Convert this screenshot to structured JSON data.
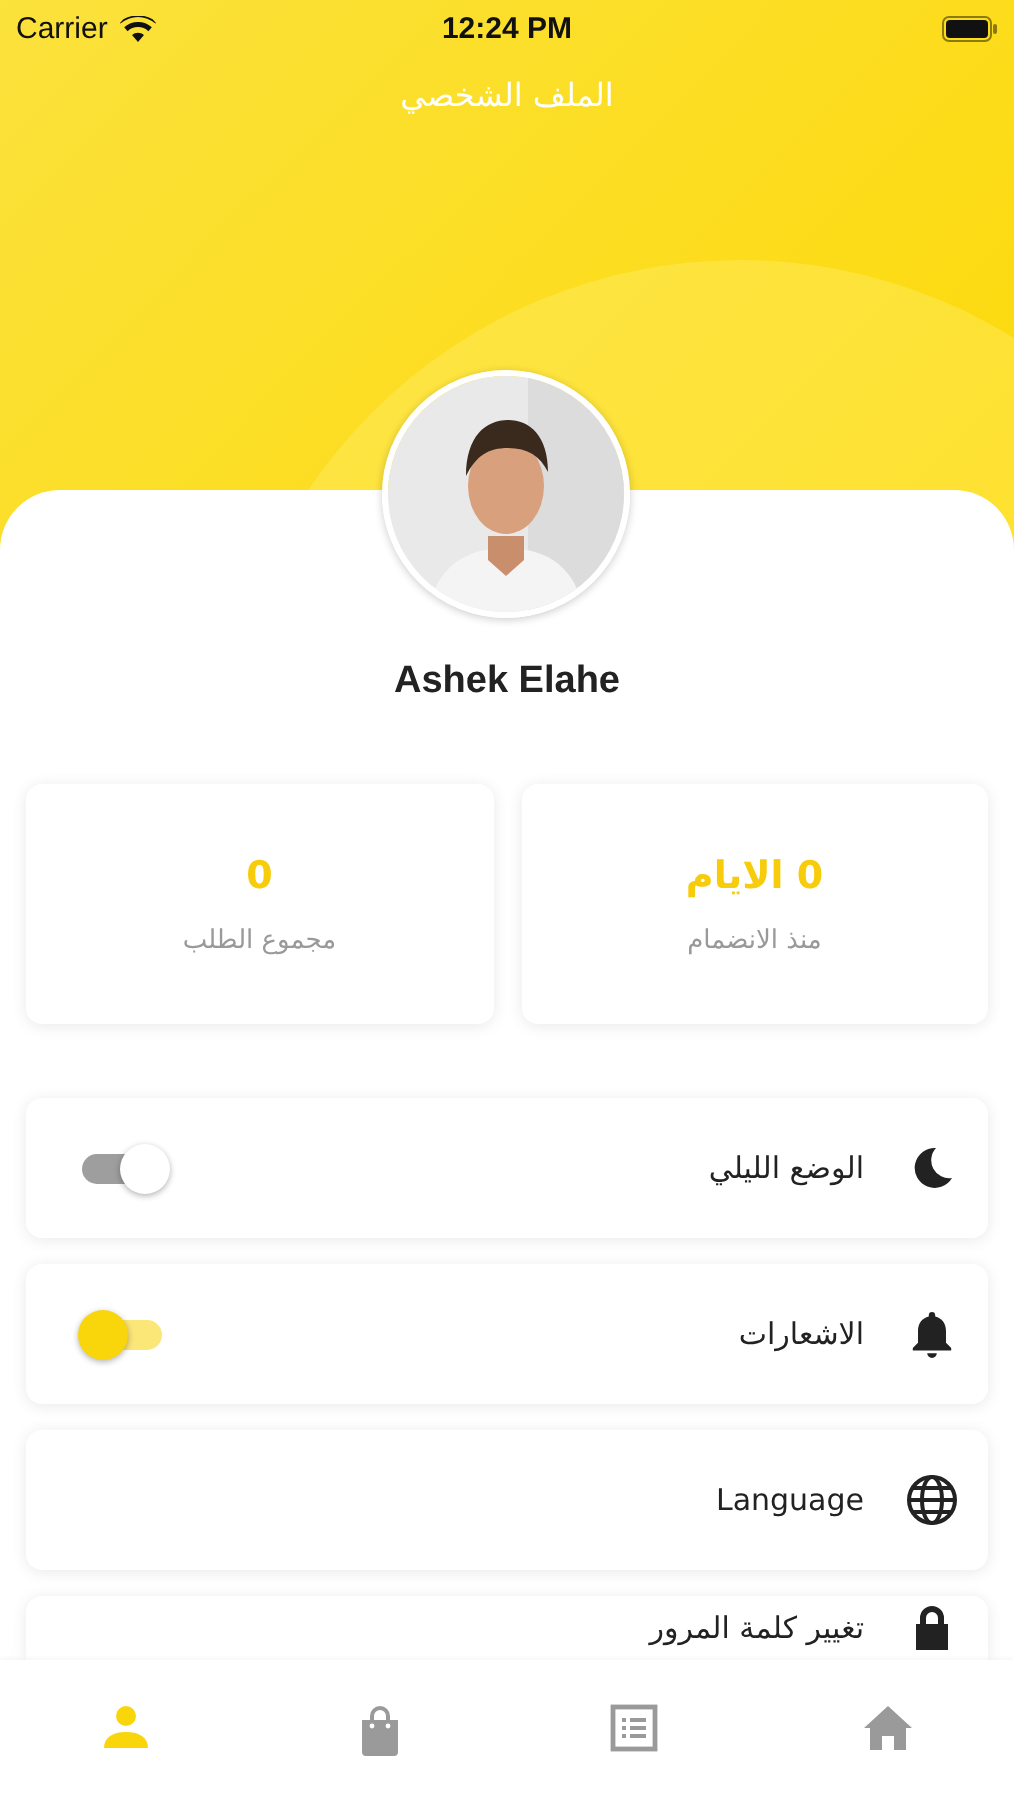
{
  "status_bar": {
    "carrier": "Carrier",
    "time": "12:24 PM"
  },
  "header": {
    "title": "الملف الشخصي"
  },
  "profile": {
    "name": "Ashek Elahe"
  },
  "stats": [
    {
      "value": "0 الايام",
      "label": "منذ الانضمام"
    },
    {
      "value": "0",
      "label": "مجموع الطلب"
    }
  ],
  "settings": [
    {
      "kind": "toggle",
      "label": "الوضع الليلي",
      "on": false
    },
    {
      "kind": "toggle",
      "label": "الاشعارات",
      "on": true
    },
    {
      "kind": "link",
      "label": "Language"
    },
    {
      "kind": "link",
      "label": "تغيير كلمة المرور"
    }
  ],
  "tabs": [
    {
      "kind": "home",
      "selected": false
    },
    {
      "kind": "list",
      "selected": false
    },
    {
      "kind": "bag",
      "selected": false
    },
    {
      "kind": "person",
      "selected": true
    }
  ]
}
